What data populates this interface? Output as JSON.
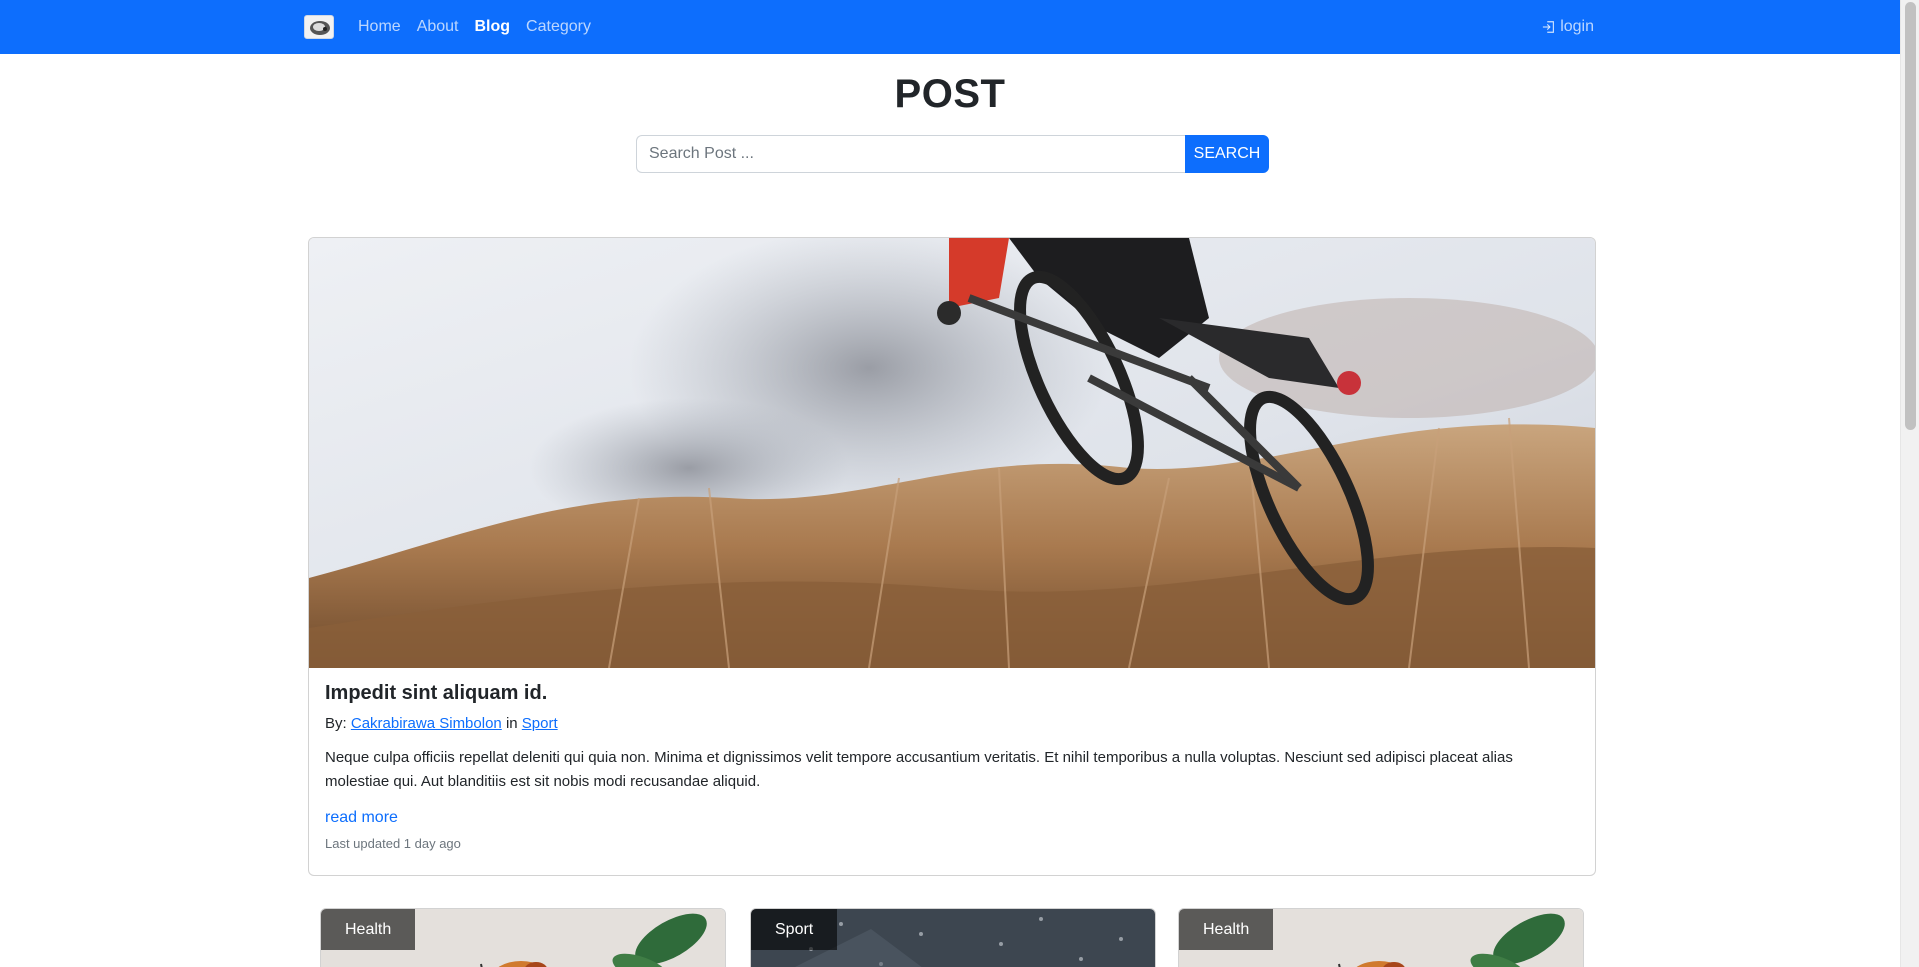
{
  "nav": {
    "links": [
      {
        "label": "Home",
        "active": false
      },
      {
        "label": "About",
        "active": false
      },
      {
        "label": "Blog",
        "active": true
      },
      {
        "label": "Category",
        "active": false
      }
    ],
    "login_label": "login",
    "brand_color": "#0d6efd"
  },
  "header": {
    "title": "POST",
    "search_placeholder": "Search Post ...",
    "search_value": "",
    "search_button": "SEARCH"
  },
  "featured": {
    "title": "Impedit sint aliquam id.",
    "by_prefix": "By:",
    "author": "Cakrabirawa Simbolon",
    "in_word": "in",
    "category": "Sport",
    "excerpt": "Neque culpa officiis repellat deleniti qui quia non. Minima et dignissimos velit tempore accusantium veritatis. Et nihil temporibus a nulla voluptas. Nesciunt sed adipisci placeat alias molestiae qui. Aut blanditiis est sit nobis modi recusandae aliquid.",
    "read_more": "read more",
    "updated": "Last updated 1 day ago"
  },
  "posts": [
    {
      "category": "Health"
    },
    {
      "category": "Sport"
    },
    {
      "category": "Health"
    }
  ]
}
